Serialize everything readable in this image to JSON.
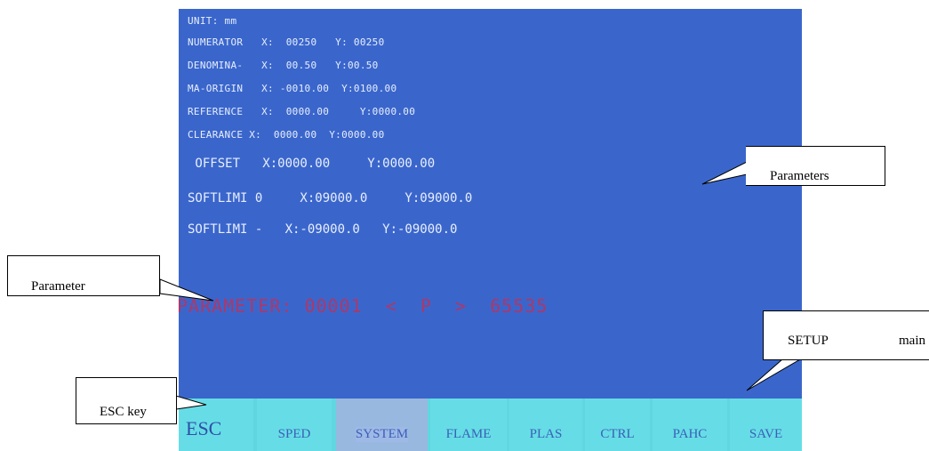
{
  "screen": {
    "parameters": [
      {
        "text": "UNIT: mm",
        "size": "small"
      },
      {
        "text": "NUMERATOR   X:  00250   Y: 00250",
        "size": "small"
      },
      {
        "text": "DENOMINA-   X:  00.50   Y:00.50",
        "size": "small"
      },
      {
        "text": "MA-ORIGIN   X: -0010.00  Y:0100.00",
        "size": "small"
      },
      {
        "text": "REFERENCE   X:  0000.00     Y:0000.00",
        "size": "small"
      },
      {
        "text": "CLEARANCE X:  0000.00  Y:0000.00",
        "size": "small"
      },
      {
        "text": " OFFSET   X:0000.00     Y:0000.00",
        "size": "big"
      },
      {
        "text": "SOFTLIMI 0     X:09000.0     Y:09000.0",
        "size": "big"
      },
      {
        "text": "SOFTLIMI -   X:-09000.0   Y:-09000.0",
        "size": "big"
      }
    ],
    "readout": "PARAMETER: 00001  <  P  >  65535",
    "softkeys": [
      {
        "label": "ESC",
        "active": false
      },
      {
        "label": "SPED",
        "active": false
      },
      {
        "label": "SYSTEM",
        "active": true
      },
      {
        "label": "FLAME",
        "active": false
      },
      {
        "label": "PLAS",
        "active": false
      },
      {
        "label": "CTRL",
        "active": false
      },
      {
        "label": "PAHC",
        "active": false
      },
      {
        "label": "SAVE",
        "active": false
      }
    ],
    "colors": {
      "background": "#3a66cc",
      "softkey_bar": "#5fd6e0",
      "readout": "#c0305a"
    }
  },
  "callouts": {
    "parameters": "Parameters",
    "parameter": "Parameter",
    "setup_left": "SETUP",
    "setup_right": "main",
    "esc_key": "ESC key"
  }
}
